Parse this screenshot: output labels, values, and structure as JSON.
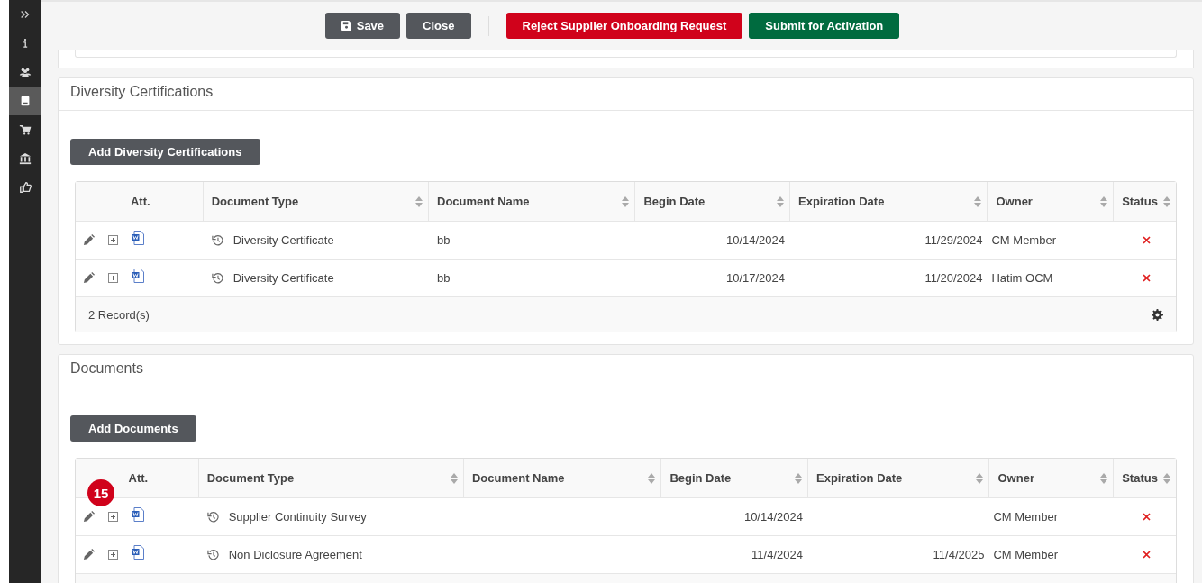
{
  "sidebar": {
    "items": [
      {
        "kind": "expand",
        "selected": false
      },
      {
        "kind": "info",
        "selected": false
      },
      {
        "kind": "people",
        "selected": false
      },
      {
        "kind": "book",
        "selected": true
      },
      {
        "kind": "cart",
        "selected": false
      },
      {
        "kind": "bank",
        "selected": false
      },
      {
        "kind": "thumbs",
        "selected": false
      }
    ]
  },
  "toolbar": {
    "buttons": [
      {
        "label": "Save",
        "kind": "default"
      },
      {
        "label": "Close",
        "kind": "default"
      },
      {
        "label": "Reject Supplier Onboarding Request",
        "kind": "danger"
      },
      {
        "label": "Submit for Activation",
        "kind": "success"
      }
    ]
  },
  "sections": [
    {
      "title": "Diversity Certifications",
      "add_button": "Add Diversity Certifications",
      "columns": [
        {
          "label": "Att.",
          "sortable": false
        },
        {
          "label": "Document Type",
          "sortable": true
        },
        {
          "label": "Document Name",
          "sortable": true
        },
        {
          "label": "Begin Date",
          "sortable": true
        },
        {
          "label": "Expiration Date",
          "sortable": true
        },
        {
          "label": "Owner",
          "sortable": true
        },
        {
          "label": "Status",
          "sortable": true
        }
      ],
      "rows": [
        {
          "document_type": "Diversity Certificate",
          "document_name": "bb",
          "begin_date": "10/14/2024",
          "expiration_date": "11/29/2024",
          "owner": "CM Member"
        },
        {
          "document_type": "Diversity Certificate",
          "document_name": "bb",
          "begin_date": "10/17/2024",
          "expiration_date": "11/20/2024",
          "owner": "Hatim OCM"
        }
      ],
      "footer": "2 Record(s)"
    },
    {
      "title": "Documents",
      "add_button": "Add Documents",
      "columns": [
        {
          "label": "Att.",
          "sortable": false
        },
        {
          "label": "Document Type",
          "sortable": true
        },
        {
          "label": "Document Name",
          "sortable": true
        },
        {
          "label": "Begin Date",
          "sortable": true
        },
        {
          "label": "Expiration Date",
          "sortable": true
        },
        {
          "label": "Owner",
          "sortable": true
        },
        {
          "label": "Status",
          "sortable": true
        }
      ],
      "rows": [
        {
          "document_type": "Supplier Continuity Survey",
          "begin_date": "10/14/2024",
          "owner": "CM Member",
          "badge": "15"
        },
        {
          "document_type": "Non Diclosure Agreement",
          "begin_date": "11/4/2024",
          "expiration_date": "11/4/2025",
          "owner": "CM Member"
        }
      ]
    }
  ]
}
